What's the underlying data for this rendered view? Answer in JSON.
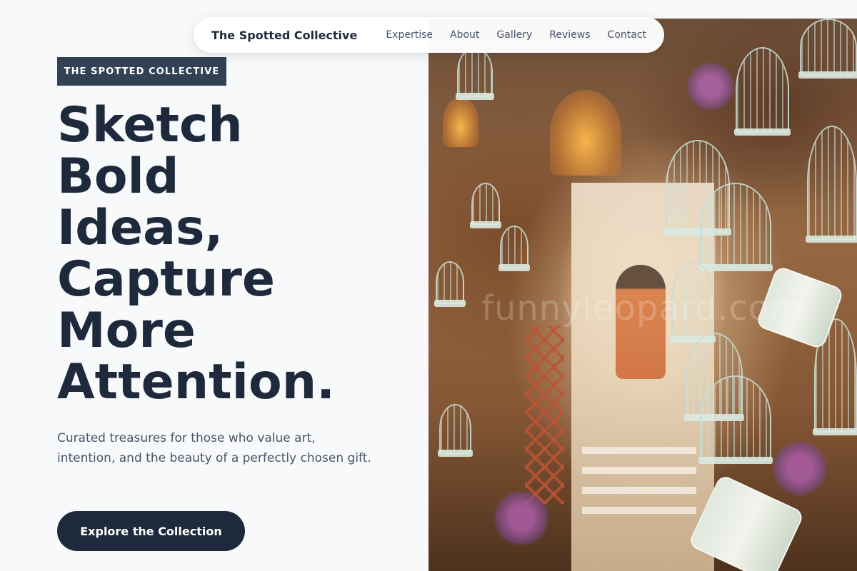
{
  "nav": {
    "brand": "The Spotted Collective",
    "links": [
      "Expertise",
      "About",
      "Gallery",
      "Reviews",
      "Contact"
    ]
  },
  "hero": {
    "badge": "THE SPOTTED COLLECTIVE",
    "headline_lines": [
      "Sketch",
      "Bold",
      "Ideas,",
      "Capture",
      "More",
      "Attention."
    ],
    "subtitle": "Curated treasures for those who value art, intention, and the beauty of a perfectly chosen gift.",
    "cta_label": "Explore the Collection"
  },
  "photo": {
    "watermark": "funnyleopard.com"
  },
  "colors": {
    "background": "#f8f9fa",
    "primary_dark": "#1e293b",
    "badge_bg": "#334155",
    "muted_text": "#475569",
    "nav_bg": "#ffffff"
  }
}
